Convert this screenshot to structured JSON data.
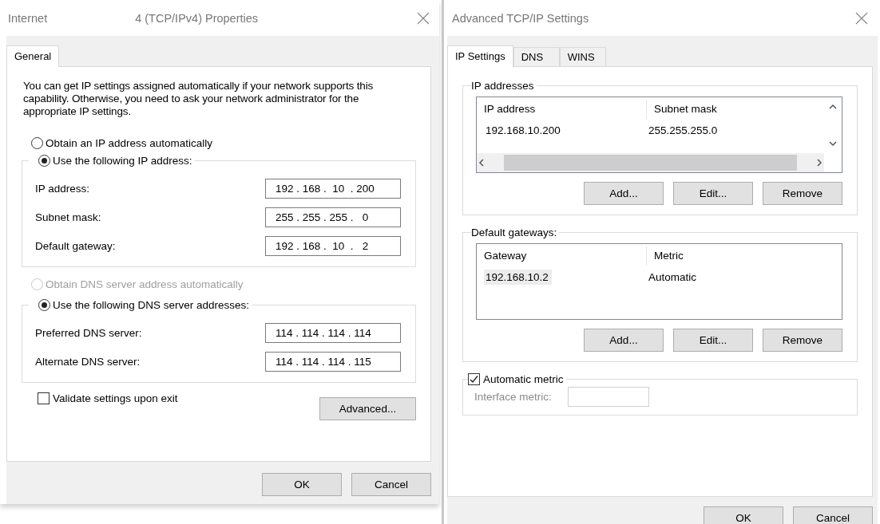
{
  "ipv4_properties": {
    "title_parts": [
      "Internet",
      "4 (TCP/IPv4) Properties"
    ],
    "tabs": [
      {
        "label": "General",
        "selected": true
      }
    ],
    "description": "You can get IP settings assigned automatically if your network supports this capability. Otherwise, you need to ask your network administrator for the appropriate IP settings.",
    "ip_mode": [
      {
        "label": "Obtain an IP address automatically",
        "selected": false,
        "disabled": false
      },
      {
        "label": "Use the following IP address:",
        "selected": true,
        "disabled": false
      }
    ],
    "ip_fields": [
      {
        "label": "IP address:",
        "value": "192 . 168 .  10  . 200"
      },
      {
        "label": "Subnet mask:",
        "value": "255 . 255 . 255 .   0"
      },
      {
        "label": "Default gateway:",
        "value": "192 . 168 .  10  .   2"
      }
    ],
    "dns_mode": [
      {
        "label": "Obtain DNS server address automatically",
        "selected": false,
        "disabled": true
      },
      {
        "label": "Use the following DNS server addresses:",
        "selected": true,
        "disabled": false
      }
    ],
    "dns_fields": [
      {
        "label": "Preferred DNS server:",
        "value": "114 . 114 . 114 . 114"
      },
      {
        "label": "Alternate DNS server:",
        "value": "114 . 114 . 114 . 115"
      }
    ],
    "validate": {
      "label": "Validate settings upon exit",
      "checked": false
    },
    "advanced_button": "Advanced...",
    "buttons": [
      "OK",
      "Cancel"
    ]
  },
  "advanced_settings": {
    "title": "Advanced TCP/IP Settings",
    "tabs": [
      {
        "label": "IP Settings",
        "selected": true
      },
      {
        "label": "DNS",
        "selected": false
      },
      {
        "label": "WINS",
        "selected": false
      }
    ],
    "ip_addresses": {
      "title": "IP addresses",
      "columns": [
        "IP address",
        "Subnet mask"
      ],
      "rows": [
        {
          "cells": [
            "192.168.10.200",
            "255.255.255.0"
          ],
          "selected": false
        }
      ],
      "buttons": [
        "Add...",
        "Edit...",
        "Remove"
      ]
    },
    "default_gateways": {
      "title": "Default gateways:",
      "columns": [
        "Gateway",
        "Metric"
      ],
      "rows": [
        {
          "cells": [
            "192.168.10.2",
            "Automatic"
          ],
          "selected": true
        }
      ],
      "buttons": [
        "Add...",
        "Edit...",
        "Remove"
      ]
    },
    "automatic_metric": {
      "label": "Automatic metric",
      "checked": true
    },
    "interface_metric": {
      "label": "Interface metric:",
      "disabled": true
    },
    "buttons": [
      "OK",
      "Cancel"
    ]
  }
}
